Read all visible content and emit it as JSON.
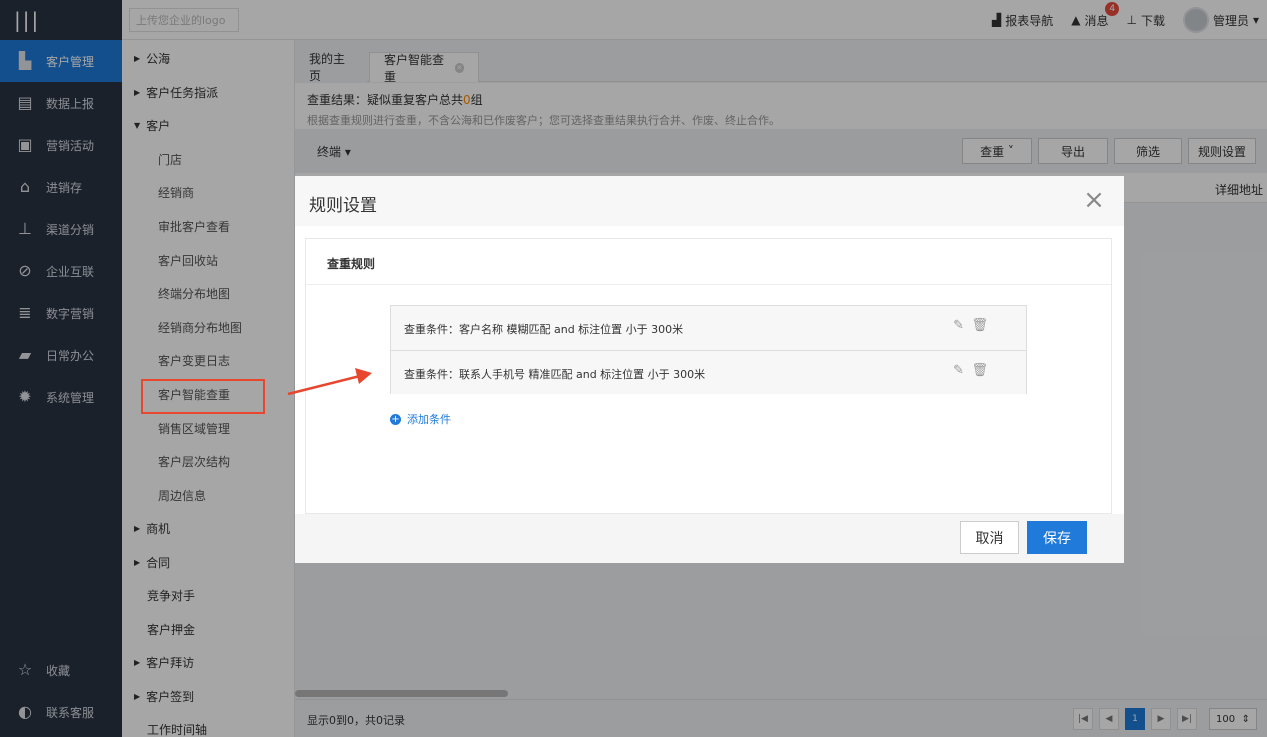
{
  "topbar": {
    "logo_placeholder": "上传您企业的logo",
    "report_nav": "报表导航",
    "messages": "消息",
    "message_count": "4",
    "download": "下载",
    "user": "管理员"
  },
  "leftnav": {
    "items": [
      {
        "label": "客户管理",
        "icon": "building-icon"
      },
      {
        "label": "数据上报",
        "icon": "report-icon"
      },
      {
        "label": "营销活动",
        "icon": "bookmark-icon"
      },
      {
        "label": "进销存",
        "icon": "warehouse-icon"
      },
      {
        "label": "渠道分销",
        "icon": "hierarchy-icon"
      },
      {
        "label": "企业互联",
        "icon": "link-icon"
      },
      {
        "label": "数字营销",
        "icon": "stack-icon"
      },
      {
        "label": "日常办公",
        "icon": "briefcase-icon"
      },
      {
        "label": "系统管理",
        "icon": "gear-icon"
      }
    ],
    "favorites": "收藏",
    "support": "联系客服"
  },
  "subnav": {
    "items": [
      {
        "label": "公海",
        "type": "group",
        "expanded": false
      },
      {
        "label": "客户任务指派",
        "type": "group",
        "expanded": false
      },
      {
        "label": "客户",
        "type": "group",
        "expanded": true
      },
      {
        "label": "门店",
        "type": "child"
      },
      {
        "label": "经销商",
        "type": "child"
      },
      {
        "label": "审批客户查看",
        "type": "child"
      },
      {
        "label": "客户回收站",
        "type": "child"
      },
      {
        "label": "终端分布地图",
        "type": "child"
      },
      {
        "label": "经销商分布地图",
        "type": "child"
      },
      {
        "label": "客户变更日志",
        "type": "child"
      },
      {
        "label": "客户智能查重",
        "type": "child",
        "selected": true
      },
      {
        "label": "销售区域管理",
        "type": "child"
      },
      {
        "label": "客户层次结构",
        "type": "child"
      },
      {
        "label": "周边信息",
        "type": "child"
      },
      {
        "label": "商机",
        "type": "group",
        "expanded": false
      },
      {
        "label": "合同",
        "type": "group",
        "expanded": false
      },
      {
        "label": "竞争对手",
        "type": "plain"
      },
      {
        "label": "客户押金",
        "type": "plain"
      },
      {
        "label": "客户拜访",
        "type": "group",
        "expanded": false
      },
      {
        "label": "客户签到",
        "type": "group",
        "expanded": false
      },
      {
        "label": "工作时间轴",
        "type": "plain"
      }
    ]
  },
  "main": {
    "tabs": [
      {
        "label": "我的主页"
      },
      {
        "label": "客户智能查重"
      }
    ],
    "result_title_prefix": "查重结果：疑似重复客户总共",
    "result_count": "0",
    "result_title_suffix": "组",
    "result_desc": "根据查重规则进行查重，不含公海和已作废客户；您可选择查重结果执行合并、作废、终止合作。",
    "filter_label": "终端",
    "buttons": {
      "dedupe": "查重",
      "export": "导出",
      "filter": "筛选",
      "rules": "规则设置"
    },
    "column_address": "详细地址",
    "footer_text": "显示0到0，共0记录",
    "page_current": "1",
    "page_size": "100"
  },
  "modal": {
    "title": "规则设置",
    "section_title": "查重规则",
    "rules": [
      {
        "text": "查重条件：客户名称 模糊匹配 and 标注位置 小于 300米"
      },
      {
        "text": "查重条件：联系人手机号 精准匹配 and 标注位置 小于 300米"
      }
    ],
    "add_condition": "添加条件",
    "cancel": "取消",
    "save": "保存"
  },
  "colors": {
    "accent": "#1f7ad9",
    "sidebar": "#2a3342",
    "highlight": "#e8462e"
  }
}
